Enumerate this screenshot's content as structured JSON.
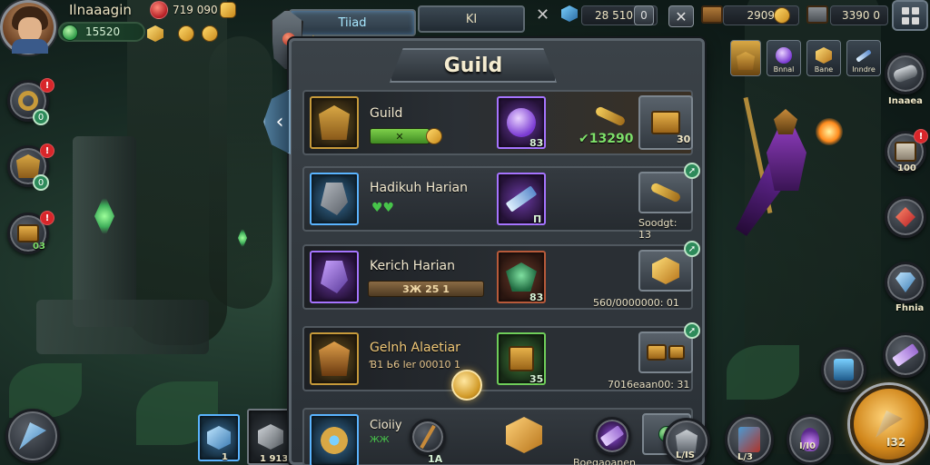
{
  "player": {
    "name": "Ilnaaagin",
    "gems": "15520"
  },
  "top_resources": {
    "red_val": "719 090",
    "res1": "28 510",
    "res2": "2909",
    "res3": "3390 0"
  },
  "top_tabs": [
    {
      "label": "Tiiad",
      "active": true
    },
    {
      "label": "KI",
      "active": false
    }
  ],
  "left_icons": [
    {
      "name": "ring",
      "badge": "!",
      "sub": "0"
    },
    {
      "name": "helmet",
      "badge": "!",
      "sub": "0"
    },
    {
      "name": "chest",
      "badge": "!",
      "sub": "03"
    }
  ],
  "panel": {
    "title": "Guild",
    "rows": [
      {
        "name": "Guild",
        "progress_label": "✕",
        "frame_num": "83",
        "right_value": "✔13290",
        "act_num": "30"
      },
      {
        "name": "Hadikuh Harian",
        "sub": "♥♥",
        "frame_num": "П",
        "right_value": "Soodgt: 13"
      },
      {
        "name": "Kerich Harian",
        "progress_label": "3Ж 25 1",
        "frame_num": "83",
        "right_value": "560/0000000: 01"
      },
      {
        "name": "Gelnh Alaetiar",
        "sub": "Ɓ1 Ь6 ler 00010 1",
        "frame_num": "35",
        "right_value": "7016eaan00: 31"
      },
      {
        "name": "Cioiiy",
        "sub": "ЖЖ",
        "frame_num": "1Α",
        "right_value": "Boegaoanen"
      }
    ]
  },
  "right_cards": [
    {
      "label": "Bnnal"
    },
    {
      "label": "Bane"
    },
    {
      "label": "Inndre"
    }
  ],
  "right_icons": [
    {
      "label": "Inaaea",
      "badge": ""
    },
    {
      "label": "100",
      "badge": "!"
    },
    {
      "label": "",
      "badge": ""
    },
    {
      "label": "Fhnia",
      "badge": ""
    }
  ],
  "bottom": {
    "left_tile_1": "1",
    "left_tile_2": "1 913",
    "right_1": "L/IS",
    "right_2": "L/3",
    "right_3": "I/I0",
    "big_btn": "I32"
  },
  "colors": {
    "gold": "#d19a28",
    "green": "#47c44a",
    "red": "#d8262a",
    "blue": "#5ab4ff"
  }
}
